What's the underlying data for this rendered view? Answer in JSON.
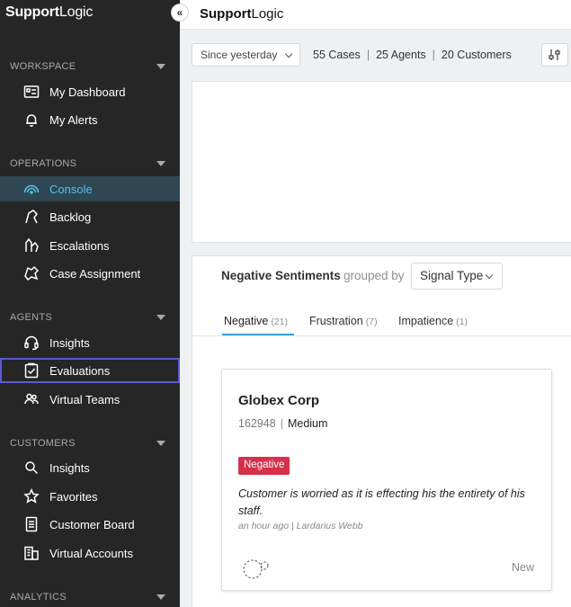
{
  "brand": {
    "bold": "Support",
    "light": "Logic"
  },
  "collapse_icon": "«",
  "sidebar": {
    "sections": [
      {
        "label": "WORKSPACE"
      },
      {
        "label": "OPERATIONS"
      },
      {
        "label": "AGENTS"
      },
      {
        "label": "CUSTOMERS"
      },
      {
        "label": "ANALYTICS"
      }
    ],
    "items": [
      {
        "label": "My Dashboard",
        "icon": "dashboard-icon"
      },
      {
        "label": "My Alerts",
        "icon": "bell-icon"
      },
      {
        "label": "Console",
        "icon": "gauge-icon",
        "active": true
      },
      {
        "label": "Backlog",
        "icon": "backlog-icon"
      },
      {
        "label": "Escalations",
        "icon": "escalation-icon"
      },
      {
        "label": "Case Assignment",
        "icon": "case-assignment-icon"
      },
      {
        "label": "Insights",
        "icon": "headset-icon"
      },
      {
        "label": "Evaluations",
        "icon": "clipboard-check-icon",
        "focused": true
      },
      {
        "label": "Virtual Teams",
        "icon": "users-icon"
      },
      {
        "label": "Insights",
        "icon": "search-icon"
      },
      {
        "label": "Favorites",
        "icon": "star-icon"
      },
      {
        "label": "Customer Board",
        "icon": "document-icon"
      },
      {
        "label": "Virtual Accounts",
        "icon": "building-icon"
      }
    ]
  },
  "filters": {
    "time_range": "Since yesterday",
    "cases": "55 Cases",
    "agents": "25 Agents",
    "customers": "20 Customers",
    "separator": "|"
  },
  "sentiments": {
    "title": "Negative Sentiments",
    "grouped_by": "grouped by",
    "group_value": "Signal Type",
    "tabs": [
      {
        "label": "Negative",
        "count": "(21)",
        "active": true
      },
      {
        "label": "Frustration",
        "count": "(7)"
      },
      {
        "label": "Impatience",
        "count": "(1)"
      }
    ]
  },
  "card": {
    "company": "Globex Corp",
    "case_id": "162948",
    "separator": "|",
    "priority": "Medium",
    "badge": "Negative",
    "text": "Customer is worried as it is effecting his the entirety of his staff.",
    "meta": "an hour ago | Lardarius Webb",
    "status": "New"
  },
  "colors": {
    "sidebar_bg": "#262626",
    "active_text": "#4fc3e8",
    "active_bg": "#2f4752",
    "badge_negative": "#d6304a",
    "tab_underline": "#3aa5d8",
    "focus_outline": "#5b5bd6"
  }
}
